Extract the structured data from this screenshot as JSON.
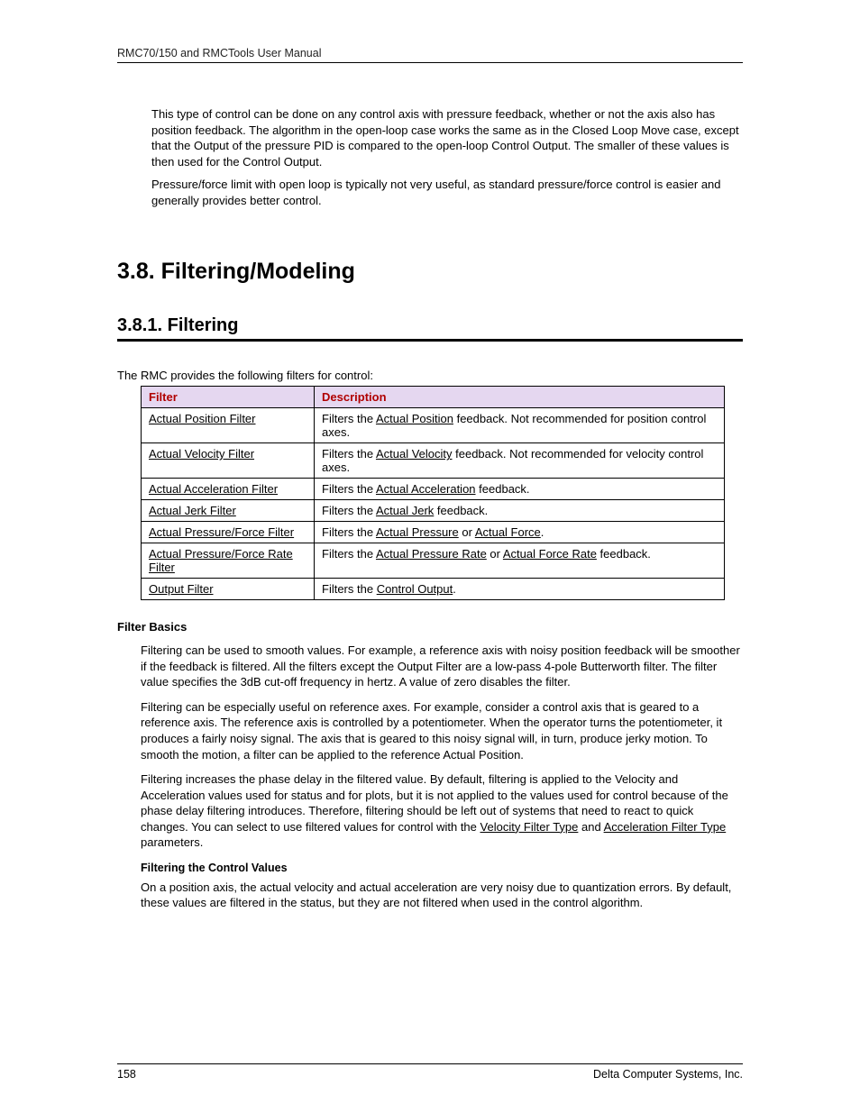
{
  "header": "RMC70/150 and RMCTools User Manual",
  "top_paragraphs": [
    "This type of control can be done on any control axis with pressure feedback, whether or not the axis also has position feedback. The algorithm in the open-loop case works the same as in the Closed Loop Move case, except that the Output of the pressure PID is compared to the open-loop Control Output. The smaller of these values is then used for the Control Output.",
    "Pressure/force limit with open loop is typically not very useful, as standard pressure/force control is easier and generally provides better control."
  ],
  "h1": "3.8. Filtering/Modeling",
  "h2": "3.8.1. Filtering",
  "intro": "The RMC provides the following filters for control:",
  "table": {
    "head": {
      "c1": "Filter",
      "c2": "Description"
    },
    "rows": [
      {
        "filter": "Actual Position Filter",
        "desc_pre": "Filters the ",
        "desc_link": "Actual Position",
        "desc_post": " feedback. Not recommended for position control axes."
      },
      {
        "filter": "Actual Velocity Filter",
        "desc_pre": "Filters the ",
        "desc_link": "Actual Velocity",
        "desc_post": " feedback. Not recommended for velocity control axes."
      },
      {
        "filter": "Actual Acceleration Filter",
        "desc_pre": "Filters the ",
        "desc_link": "Actual Acceleration",
        "desc_post": " feedback."
      },
      {
        "filter": "Actual Jerk Filter",
        "desc_pre": "Filters the ",
        "desc_link": "Actual Jerk",
        "desc_post": " feedback."
      },
      {
        "filter": "Actual Pressure/Force Filter",
        "desc_pre": "Filters the ",
        "desc_link": "Actual Pressure",
        "desc_mid": " or ",
        "desc_link2": "Actual Force",
        "desc_post": "."
      },
      {
        "filter": "Actual Pressure/Force Rate Filter",
        "desc_pre": "Filters the ",
        "desc_link": "Actual Pressure Rate",
        "desc_mid": " or ",
        "desc_link2": "Actual Force Rate",
        "desc_post": " feedback."
      },
      {
        "filter": "Output Filter",
        "desc_pre": "Filters the ",
        "desc_link": "Control Output",
        "desc_post": "."
      }
    ]
  },
  "basics_heading": "Filter Basics",
  "basics_paras": [
    "Filtering can be used to smooth values. For example, a reference axis with noisy position feedback will be smoother if the feedback is filtered. All the filters except the Output Filter are a low-pass 4-pole Butterworth filter. The filter value specifies the 3dB cut-off frequency in hertz. A value of zero disables the filter.",
    "Filtering can be especially useful on reference axes. For example, consider a control axis that is geared to a reference axis. The reference axis is controlled by a potentiometer. When the operator turns the potentiometer, it produces a fairly noisy signal. The axis that is geared to this noisy signal will, in turn, produce jerky motion. To smooth the motion, a filter can be applied to the reference Actual Position."
  ],
  "basics_para3": {
    "pre": "Filtering increases the phase delay in the filtered value. By default, filtering is applied to the Velocity and Acceleration values used for status and for plots, but it is not applied to the values used for control because of the phase delay filtering introduces. Therefore, filtering should be left out of systems that need to react to quick changes. You can select to use filtered values for control with the ",
    "link1": "Velocity Filter Type",
    "mid": " and ",
    "link2": "Acceleration Filter Type",
    "post": " parameters."
  },
  "cv_heading": "Filtering the Control Values",
  "cv_para": "On a position axis, the actual velocity and actual acceleration are very noisy due to quantization errors. By default, these values are filtered in the status, but they are not filtered when used in the control algorithm.",
  "footer": {
    "page": "158",
    "company": "Delta Computer Systems, Inc."
  }
}
